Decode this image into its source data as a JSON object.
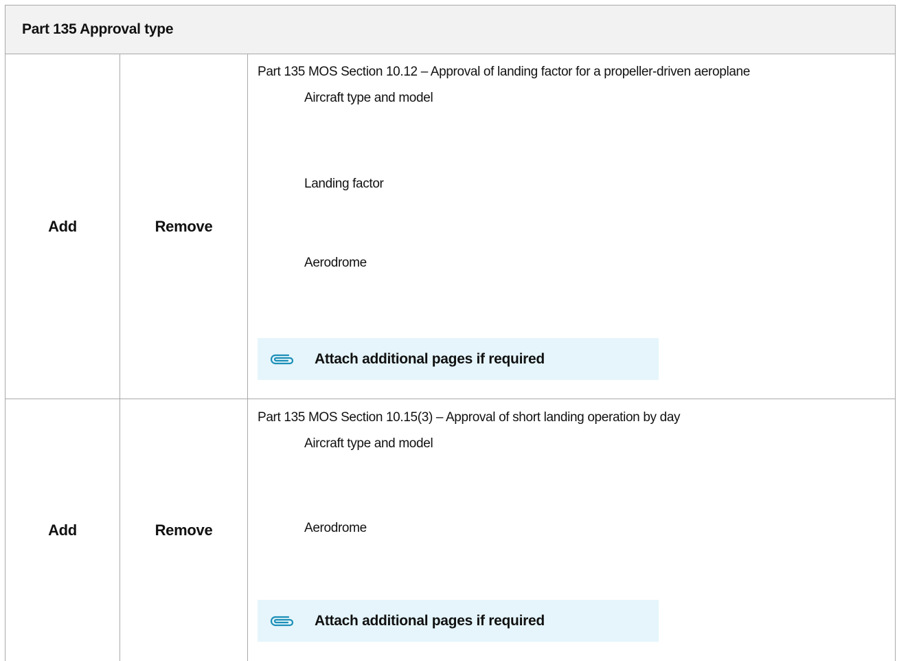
{
  "header": {
    "title": "Part 135 Approval type"
  },
  "sections": [
    {
      "add_label": "Add",
      "remove_label": "Remove",
      "title": "Part 135 MOS Section 10.12 – Approval of landing factor for a propeller-driven aeroplane",
      "fields": [
        "Aircraft type and model",
        "Landing factor",
        "Aerodrome"
      ],
      "attach_label": "Attach additional pages if required"
    },
    {
      "add_label": "Add",
      "remove_label": "Remove",
      "title": "Part 135 MOS Section 10.15(3) – Approval of short landing operation by day",
      "fields": [
        "Aircraft type and model",
        "Aerodrome"
      ],
      "attach_label": "Attach additional pages if required"
    }
  ],
  "colors": {
    "header_bg": "#f2f2f2",
    "attach_bg": "#e5f5fb",
    "icon_color": "#1b8fb8",
    "border": "#a8a8a8"
  },
  "icons": {
    "attach": "paperclip-icon"
  }
}
